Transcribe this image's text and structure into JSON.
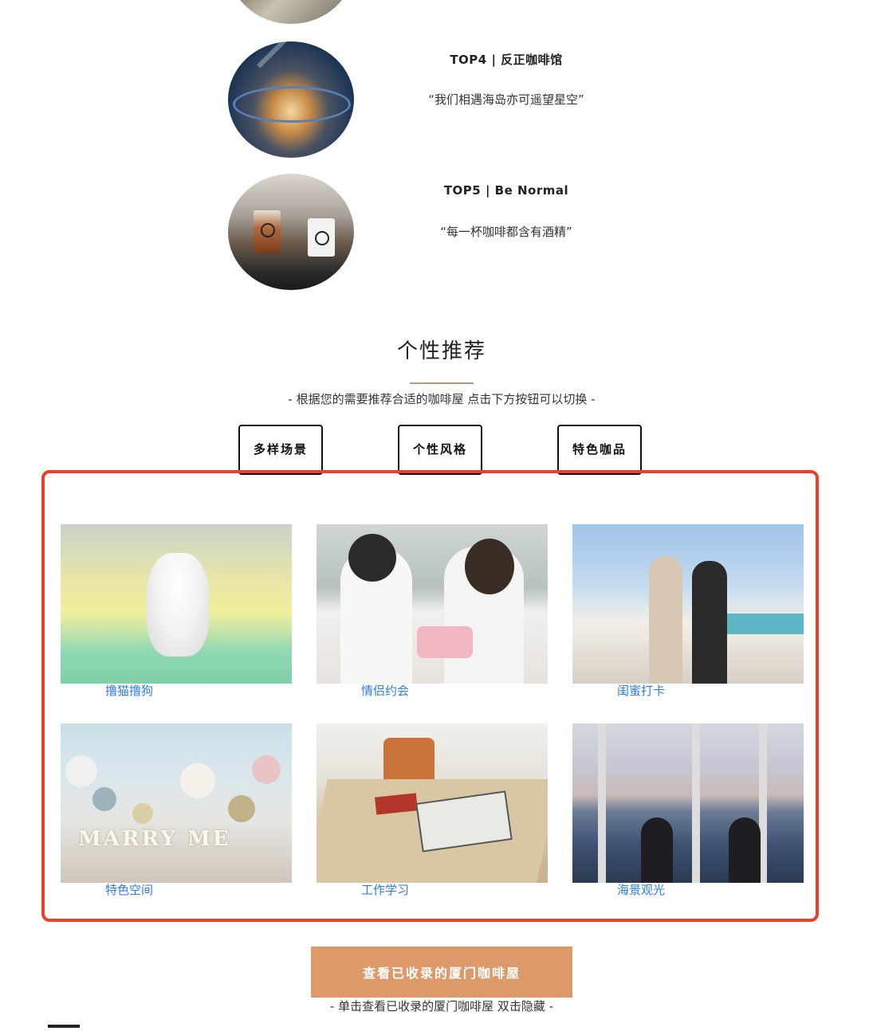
{
  "top_list": [
    {
      "title": "TOP4 | 反正咖啡馆",
      "quote": "“我们相遇海岛亦可遥望星空”"
    },
    {
      "title": "TOP5 | Be Normal",
      "quote": "“每一杯咖啡都含有酒精”"
    }
  ],
  "recommend": {
    "title": "个性推荐",
    "subtitle": "- 根据您的需要推荐合适的咖啡屋 点击下方按钮可以切换 -",
    "filters": [
      "多样场景",
      "个性风格",
      "特色咖品"
    ],
    "cards": [
      {
        "caption": "撸猫撸狗"
      },
      {
        "caption": "情侣约会"
      },
      {
        "caption": "闺蜜打卡"
      },
      {
        "caption": "特色空间"
      },
      {
        "caption": "工作学习"
      },
      {
        "caption": "海景观光"
      }
    ],
    "balloon_word": "MARRY ME"
  },
  "cta": {
    "label": "查看已收录的厦门咖啡屋",
    "hint": "- 单击查看已收录的厦门咖啡屋 双击隐藏 -"
  },
  "colors": {
    "accent": "#dc9a6a",
    "caption_link": "#2f7be6",
    "highlight_border": "#e8402a",
    "rule": "#b59a80"
  }
}
